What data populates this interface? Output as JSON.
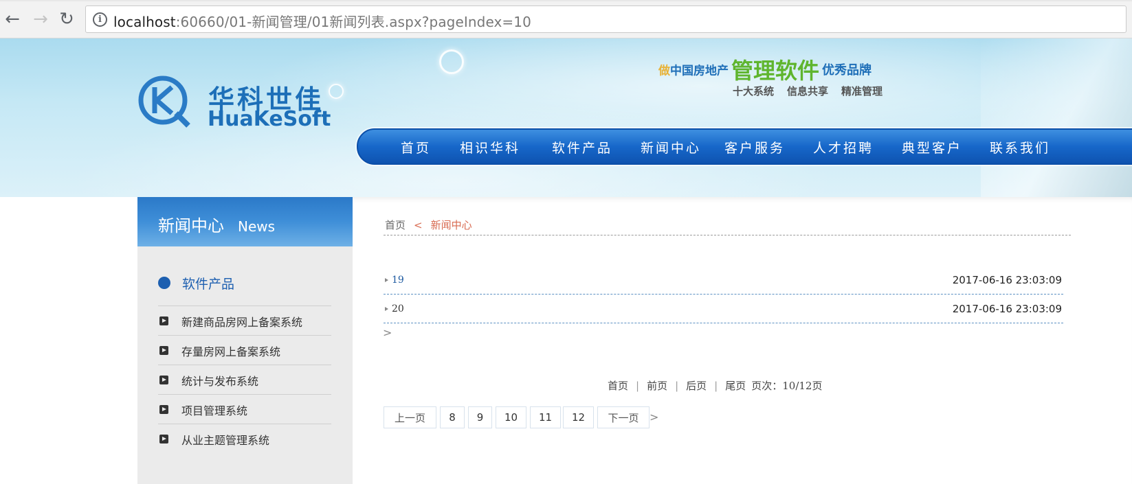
{
  "browser": {
    "url_host": "localhost",
    "url_rest": ":60660/01-新闻管理/01新闻列表.aspx?pageIndex=10",
    "info_glyph": "i"
  },
  "header": {
    "logo_cn": "华科世佳",
    "logo_en": "HuaKeSoft",
    "slogan_prefix": "做",
    "slogan_a": "中国房地产",
    "slogan_b": "管理软件",
    "slogan_c": "优秀品牌",
    "taglines": [
      "十大系统",
      "信息共享",
      "精准管理"
    ],
    "nav": [
      "首页",
      "相识华科",
      "软件产品",
      "新闻中心",
      "客户服务",
      "人才招聘",
      "典型客户",
      "联系我们"
    ]
  },
  "sidebar": {
    "title": "新闻中心",
    "title_en": "News",
    "category": "软件产品",
    "items": [
      "新建商品房网上备案系统",
      "存量房网上备案系统",
      "统计与发布系统",
      "项目管理系统",
      "从业主题管理系统"
    ]
  },
  "breadcrumb": {
    "home": "首页",
    "separator": "<",
    "current": "新闻中心"
  },
  "news": [
    {
      "title": "19",
      "date": "2017-06-16 23:03:09"
    },
    {
      "title": "20",
      "date": "2017-06-16 23:03:09"
    }
  ],
  "news_more": ">",
  "pager": {
    "first": "首页",
    "prev": "前页",
    "next": "后页",
    "last": "尾页",
    "page_info": "页次：10/12页",
    "prev_btn": "上一页",
    "pages": [
      "8",
      "9",
      "10",
      "11",
      "12"
    ],
    "next_btn": "下一页",
    "more": ">"
  },
  "colors": {
    "brand_blue": "#1d6fb8",
    "nav_blue": "#1767c9",
    "slogan_green": "#5fb52e",
    "breadcrumb_accent": "#d86a50"
  }
}
